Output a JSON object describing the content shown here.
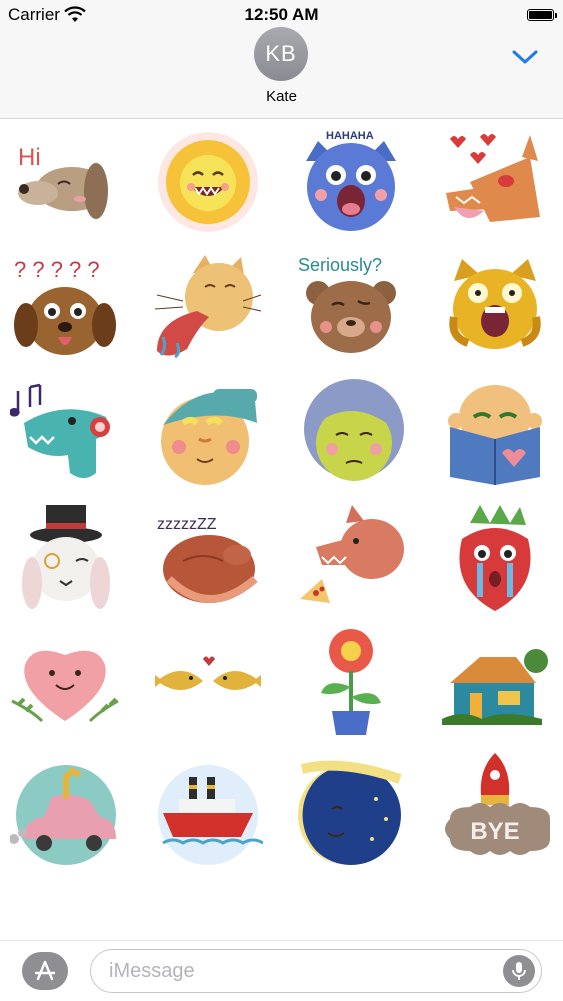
{
  "status_bar": {
    "carrier": "Carrier",
    "time": "12:50 AM",
    "battery_level": 1.0
  },
  "header": {
    "avatar_initials": "KB",
    "contact_name": "Kate",
    "collapse_icon": "chevron-down-icon",
    "accent_color": "#1a7bf2"
  },
  "stickers": {
    "row1": {
      "s1_text": "Hi",
      "s3_text": "HAHAHA"
    },
    "row2": {
      "s1_text": "? ? ? ? ?",
      "s3_text": "Seriously?"
    },
    "row6": {
      "s4_text": "BYE"
    }
  },
  "sticker_names": [
    "dog-hi",
    "lion-laughing",
    "blue-monster-haha",
    "fox-hearts",
    "dog-question-marks",
    "cat-tongue",
    "bear-seriously",
    "yellow-cat-screaming",
    "dinosaur-music",
    "boy-cap",
    "grandma",
    "bald-man-book",
    "rabbit-top-hat",
    "fox-sleeping",
    "wolf-pizza",
    "strawberry-crying",
    "heart-smiling",
    "kissing-fish",
    "potted-flower",
    "house",
    "giraffe-car",
    "steamship",
    "moon-night",
    "rocket-bye"
  ],
  "input_bar": {
    "placeholder": "iMessage",
    "apps_icon": "app-store-icon",
    "mic_icon": "microphone-icon"
  }
}
